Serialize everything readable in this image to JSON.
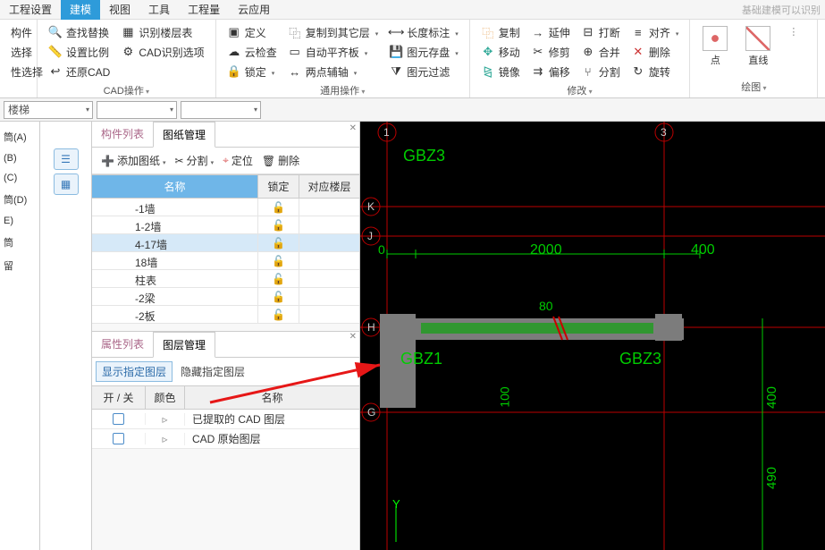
{
  "menu": {
    "items": [
      "工程设置",
      "建模",
      "视图",
      "工具",
      "工程量",
      "云应用"
    ],
    "active_index": 1,
    "right_hint": "基础建模可以识别"
  },
  "ribbon": {
    "g0": {
      "b1": "构件",
      "b2": "选择",
      "b3": "性选择"
    },
    "g1": {
      "label": "CAD操作",
      "b1": "查找替换",
      "b2": "识别楼层表",
      "b3": "设置比例",
      "b4": "CAD识别选项",
      "b5": "还原CAD"
    },
    "g2": {
      "label": "通用操作",
      "b1": "定义",
      "b2": "复制到其它层",
      "b3": "长度标注",
      "b4": "云检查",
      "b5": "自动平齐板",
      "b6": "图元存盘",
      "b7": "锁定",
      "b8": "两点辅轴",
      "b9": "图元过滤"
    },
    "g3": {
      "label": "修改",
      "b1": "复制",
      "b2": "延伸",
      "b3": "打断",
      "b4": "对齐",
      "b5": "移动",
      "b6": "修剪",
      "b7": "合并",
      "b8": "删除",
      "b9": "镜像",
      "b10": "偏移",
      "b11": "分割",
      "b12": "旋转"
    },
    "g4": {
      "label": "绘图",
      "b1": "点",
      "b2": "直线"
    }
  },
  "subbar": {
    "combo1": "楼梯"
  },
  "left_edge": [
    "筒(A)",
    "(B)",
    "(C)",
    "筒(D)",
    "E)",
    "筒",
    "留"
  ],
  "panel_top": {
    "tabs": [
      "构件列表",
      "图纸管理"
    ],
    "active": 1,
    "toolbar": {
      "add": "添加图纸",
      "split": "分割",
      "locate": "定位",
      "delete": "删除"
    },
    "cols": {
      "name": "名称",
      "lock": "锁定",
      "floor": "对应楼层"
    },
    "rows": [
      {
        "name": "-1墙"
      },
      {
        "name": "1-2墙"
      },
      {
        "name": "4-17墙",
        "selected": true
      },
      {
        "name": "18墙"
      },
      {
        "name": "柱表"
      },
      {
        "name": "-2梁"
      },
      {
        "name": "-2板"
      }
    ]
  },
  "panel_bottom": {
    "tabs": [
      "属性列表",
      "图层管理"
    ],
    "active": 1,
    "buttons": {
      "show": "显示指定图层",
      "hide": "隐藏指定图层"
    },
    "cols": {
      "onoff": "开 / 关",
      "color": "颜色",
      "name": "名称"
    },
    "rows": [
      {
        "name": "已提取的 CAD 图层"
      },
      {
        "name": "CAD 原始图层"
      }
    ]
  },
  "canvas_labels": {
    "gbz3_top": "GBZ3",
    "gbz1": "GBZ1",
    "gbz3_right": "GBZ3",
    "axis1": "1",
    "axis3": "3",
    "axisK": "K",
    "axisJ": "J",
    "axisH": "H",
    "axisG": "G",
    "dim_zero": "0",
    "dim_2000": "2000",
    "dim_400": "400",
    "dim_80": "80",
    "dim_100": "100",
    "dim_400v": "400",
    "dim_490": "490",
    "y_label": "Y"
  }
}
